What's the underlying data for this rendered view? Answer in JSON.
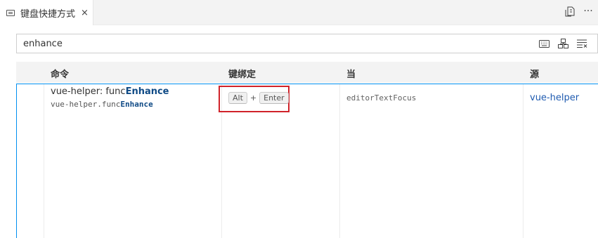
{
  "tab": {
    "title": "键盘快捷方式",
    "close": "×"
  },
  "actions": {
    "more": "···"
  },
  "search": {
    "value": "enhance"
  },
  "columns": {
    "command": "命令",
    "keybinding": "键绑定",
    "when": "当",
    "source": "源"
  },
  "row": {
    "title_prefix": "vue-helper: func",
    "title_highlight": "Enhance",
    "id_prefix": "vue-helper.func",
    "id_highlight": "Enhance",
    "key1": "Alt",
    "plus": "+",
    "key2": "Enter",
    "when": "editorTextFocus",
    "source": "vue-helper"
  },
  "colors": {
    "accent": "#0090f1",
    "highlight_box": "#d0232a",
    "match": "#0f4a85",
    "link": "#1f5bb0"
  }
}
